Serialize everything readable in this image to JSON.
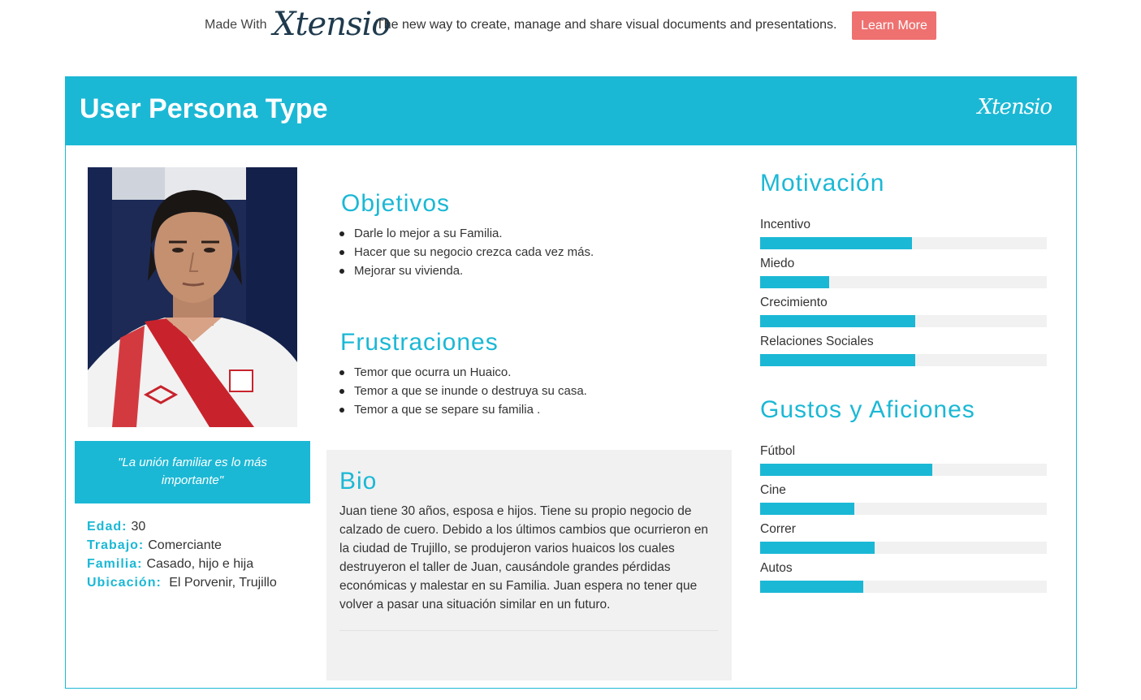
{
  "banner": {
    "made_with": "Made With",
    "logo": "Xtensio",
    "tagline": "The new way to create, manage and share visual documents and presentations.",
    "learn_more": "Learn More"
  },
  "persona": {
    "title": "User Persona Type",
    "logo": "Xtensio",
    "quote": "\"La unión familiar es lo más importante\"",
    "facts": [
      {
        "label": "Edad:",
        "value": "30"
      },
      {
        "label": "Trabajo:",
        "value": "Comerciante"
      },
      {
        "label": "Familia:",
        "value": "Casado, hijo e hija"
      },
      {
        "label": "Ubicación:",
        "value": " El Porvenir, Trujillo"
      }
    ],
    "objetivos": {
      "title": "Objetivos",
      "items": [
        "Darle lo mejor a su Familia.",
        "Hacer que su negocio crezca cada vez más.",
        "Mejorar su vivienda."
      ]
    },
    "frustraciones": {
      "title": "Frustraciones",
      "items": [
        "Temor que ocurra un Huaico.",
        "Temor a que se inunde o destruya su casa.",
        "Temor a que se separe su familia ."
      ]
    },
    "bio": {
      "title": "Bio",
      "text": "Juan tiene 30 años, esposa e hijos. Tiene su propio negocio de calzado de cuero. Debido a los últimos cambios que ocurrieron en la ciudad de Trujillo,  se produjeron varios huaicos los cuales destruyeron el taller de Juan, causándole grandes pérdidas económicas y malestar en su Familia. Juan espera no tener que volver a pasar una situación similar en un futuro."
    },
    "motivacion": {
      "title": "Motivación",
      "bars": [
        {
          "label": "Incentivo",
          "value": 0.53
        },
        {
          "label": "Miedo",
          "value": 0.24
        },
        {
          "label": "Crecimiento",
          "value": 0.54
        },
        {
          "label": "Relaciones Sociales",
          "value": 0.54
        }
      ]
    },
    "gustos": {
      "title": "Gustos y Aficiones",
      "bars": [
        {
          "label": "Fútbol",
          "value": 0.6
        },
        {
          "label": "Cine",
          "value": 0.33
        },
        {
          "label": "Correr",
          "value": 0.4
        },
        {
          "label": "Autos",
          "value": 0.36
        }
      ]
    }
  },
  "colors": {
    "accent": "#1bb8d5",
    "button": "#ee7170",
    "bio_bg": "#f1f1f1"
  }
}
